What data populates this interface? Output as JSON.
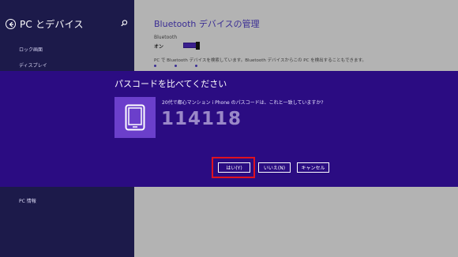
{
  "left_pane": {
    "title": "PC とデバイス",
    "items": [
      {
        "label": "ロック画面"
      },
      {
        "label": "ディスプレイ"
      },
      {
        "label": "PC 情報"
      }
    ]
  },
  "content": {
    "title": "Bluetooth デバイスの管理",
    "bluetooth_label": "Bluetooth",
    "bluetooth_state": "オン",
    "description": "PC で Bluetooth デバイスを検索しています。Bluetooth デバイスからこの PC を検出することもできます。"
  },
  "dialog": {
    "title": "パスコードを比べてください",
    "message": "20代で都心マンション i Phone のパスコードは、これと一致していますか?",
    "passcode": "114118",
    "yes_label": "はい(Y)",
    "no_label": "いいえ(N)",
    "cancel_label": "キャンセル"
  },
  "colors": {
    "dialog_bg": "#2b0c82",
    "device_tile": "#6b3fcb",
    "left_pane_bg": "#1c1a4a",
    "highlight": "#e0121f"
  },
  "icons": [
    "back-arrow-icon",
    "search-icon",
    "phone-icon"
  ]
}
